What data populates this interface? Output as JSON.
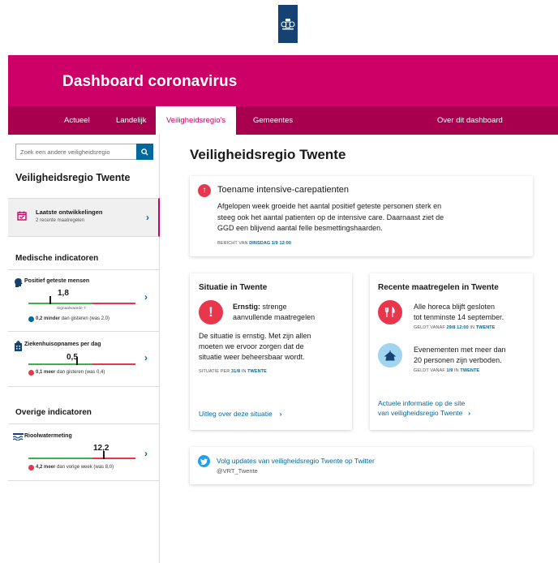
{
  "header": {
    "title": "Dashboard coronavirus",
    "nav": [
      "Actueel",
      "Landelijk",
      "Veiligheidsregio's",
      "Gemeentes",
      "Over dit dashboard"
    ]
  },
  "sidebar": {
    "search_placeholder": "Zoek een andere veiligheidsregio",
    "region_title": "Veiligheidsregio Twente",
    "latest": {
      "title": "Laatste ontwikkelingen",
      "subtitle": "2 recente maatregelen"
    },
    "medical_title": "Medische indicatoren",
    "indicators": [
      {
        "title": "Positief geteste mensen",
        "value": "1,8",
        "signal_label": "Signaalwaarde 7",
        "note_bold": "0,2 minder",
        "note_rest": " dan gisteren (was 2,0)",
        "bar_level": 0.2,
        "change": "down"
      },
      {
        "title": "Ziekenhuisopnames per dag",
        "value": "0,5",
        "note_bold": "0,1 meer",
        "note_rest": " dan gisteren (was 0,4)",
        "bar_level": 0.45,
        "change": "up"
      }
    ],
    "other_title": "Overige indicatoren",
    "other_indicators": [
      {
        "title": "Rioolwatermeting",
        "value": "12,2",
        "note_bold": "4,2 meer",
        "note_rest": " dan vorige week (was 8,0)",
        "bar_level": 0.7,
        "change": "up"
      }
    ]
  },
  "main": {
    "title": "Veiligheidsregio Twente",
    "alert": {
      "heading": "Toename intensive-carepatienten",
      "lines": [
        "Afgelopen week groeide het aantal positief geteste personen sterk en",
        "steeg ook het aantal patienten op de intensive care. Daarnaast ziet de",
        "GGD een blijvend aantal felle besmettingshaarden."
      ],
      "meta_prefix": "BERICHT VAN ",
      "meta_date": "DINSDAG 1/9 12:00"
    },
    "situation": {
      "title": "Situatie in Twente",
      "status_bold": "Ernstig:",
      "status_rest": " strenge",
      "status_line2": "aanvullende maatregelen",
      "lines": [
        "De situatie is ernstig. Met zijn allen",
        "moeten we ervoor zorgen dat de",
        "situatie weer beheersbaar wordt."
      ],
      "meta_prefix": "SITUATIE PER ",
      "meta_date": "31/8",
      "meta_mid": " IN ",
      "meta_region": "TWENTE",
      "link": "Uitleg over deze situatie"
    },
    "measures": {
      "title": "Recente maatregelen in Twente",
      "items": [
        {
          "line1": "Alle horeca blijft gesloten",
          "line2": "tot tenminste 14 september.",
          "meta_prefix": "GELDT VANAF ",
          "meta_date": "29/8 12:00",
          "meta_mid": " IN ",
          "meta_region": "TWENTE"
        },
        {
          "line1": "Evenementen met meer dan",
          "line2": "20 personen zijn verboden.",
          "meta_prefix": "GELDT VANAF ",
          "meta_date": "1/9",
          "meta_mid": " IN ",
          "meta_region": "TWENTE"
        }
      ],
      "link_line1": "Actuele informatie op de site",
      "link_line2": "van veiligheidsregio Twente"
    },
    "twitter": {
      "text": "Volg updates van veiligheidsregio Twente op Twitter",
      "handle": "@VRT_Twente"
    }
  },
  "colors": {
    "brand": "#cc0066",
    "brand_dark": "#a8004f",
    "link": "#01689b",
    "alert": "#e8374d",
    "info": "#a0d4f0"
  }
}
